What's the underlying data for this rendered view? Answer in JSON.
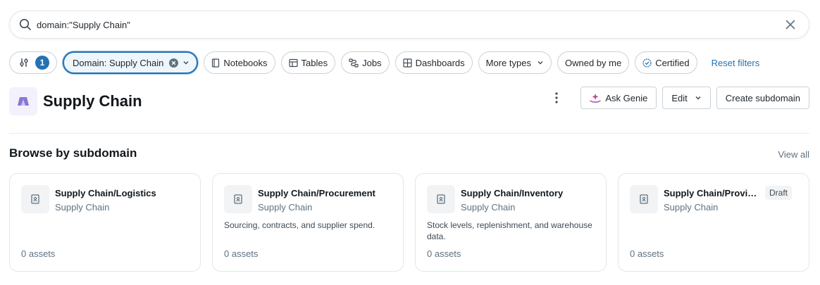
{
  "search": {
    "value": "domain:\"Supply Chain\"",
    "icon": "search-icon",
    "clear_icon": "close-icon"
  },
  "filters": {
    "filter_count": "1",
    "domain_chip_label": "Domain: Supply Chain",
    "types": [
      {
        "label": "Notebooks",
        "icon": "notebook-icon"
      },
      {
        "label": "Tables",
        "icon": "table-icon"
      },
      {
        "label": "Jobs",
        "icon": "workflow-icon"
      },
      {
        "label": "Dashboards",
        "icon": "dashboard-icon"
      }
    ],
    "more_types_label": "More types",
    "owned_label": "Owned by me",
    "certified_label": "Certified",
    "reset_label": "Reset filters"
  },
  "domain": {
    "title": "Supply Chain",
    "logo_icon": "domain-tent-icon",
    "ask_genie_label": "Ask Genie",
    "edit_label": "Edit",
    "create_subdomain_label": "Create subdomain"
  },
  "section": {
    "title": "Browse by subdomain",
    "view_all_label": "View all"
  },
  "subdomains": [
    {
      "name": "Supply Chain/Logistics",
      "parent": "Supply Chain",
      "description": "",
      "assets": "0 assets",
      "draft": ""
    },
    {
      "name": "Supply Chain/Procurement",
      "parent": "Supply Chain",
      "description": "Sourcing, contracts, and supplier spend.",
      "assets": "0 assets",
      "draft": ""
    },
    {
      "name": "Supply Chain/Inventory",
      "parent": "Supply Chain",
      "description": "Stock levels, replenishment, and warehouse data.",
      "assets": "0 assets",
      "draft": ""
    },
    {
      "name": "Supply Chain/Provisioning",
      "parent": "Supply Chain",
      "description": "",
      "assets": "0 assets",
      "draft": "Draft"
    }
  ],
  "colors": {
    "accent": "#2272b4",
    "genie_gradient_start": "#e8491d",
    "genie_gradient_end": "#8b44ff",
    "domain_logo": "#8a76d3"
  }
}
